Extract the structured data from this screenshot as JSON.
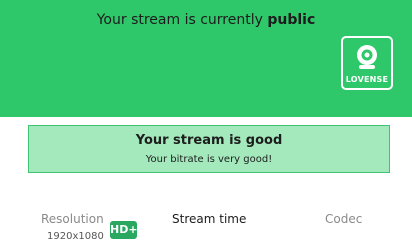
{
  "header": {
    "status_prefix": "Your stream is currently",
    "status_value": "public",
    "badge_label": "LOVENSE"
  },
  "status": {
    "title": "Your stream is good",
    "subtitle": "Your bitrate is very good!"
  },
  "stats": {
    "resolution_label": "Resolution",
    "resolution_value": "1920x1080",
    "quality_badge": "HD+",
    "stream_time_label": "Stream time",
    "codec_label": "Codec"
  },
  "colors": {
    "header_bg": "#2ec86a",
    "status_bg": "#a3e9bc",
    "badge_bg": "#2aa860"
  }
}
